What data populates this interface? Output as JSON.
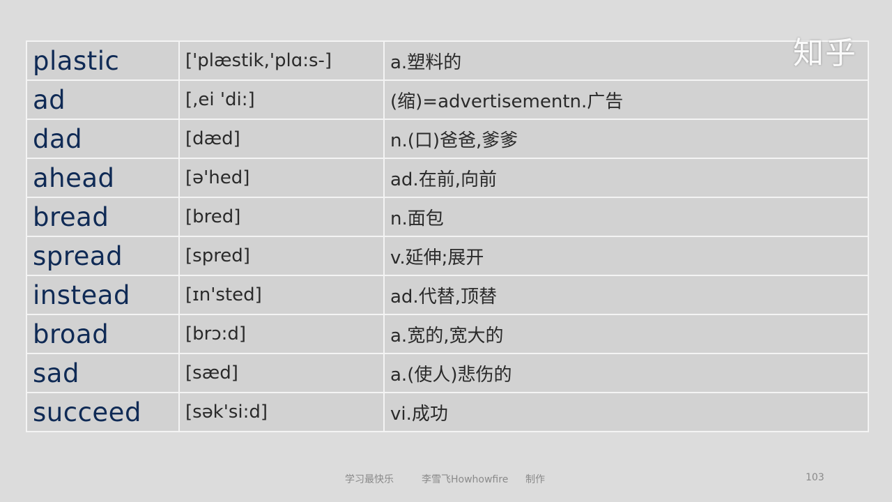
{
  "watermark": "知乎",
  "rows": [
    {
      "word": "plastic",
      "phonetic": "['plæstik,'plɑ:s-]",
      "meaning": "a.塑料的"
    },
    {
      "word": "ad",
      "phonetic": "[,ei 'di:]",
      "meaning": "(缩)=advertisementn.广告"
    },
    {
      "word": "dad",
      "phonetic": "[dæd]",
      "meaning": "n.(口)爸爸,爹爹"
    },
    {
      "word": "ahead",
      "phonetic": "[ə'hed]",
      "meaning": "ad.在前,向前"
    },
    {
      "word": "bread",
      "phonetic": "[bred]",
      "meaning": "n.面包"
    },
    {
      "word": "spread",
      "phonetic": "[spred]",
      "meaning": "v.延伸;展开"
    },
    {
      "word": "instead",
      "phonetic": "[ɪn'sted]",
      "meaning": "ad.代替,顶替"
    },
    {
      "word": "broad",
      "phonetic": "[brɔ:d]",
      "meaning": "a.宽的,宽大的"
    },
    {
      "word": "sad",
      "phonetic": "[sæd]",
      "meaning": "a.(使人)悲伤的"
    },
    {
      "word": "succeed",
      "phonetic": "[sək'si:d]",
      "meaning": "vi.成功"
    }
  ],
  "footer": {
    "slogan": "学习最快乐",
    "author": "李雪飞Howhowfire",
    "made": "制作",
    "page": "103"
  }
}
